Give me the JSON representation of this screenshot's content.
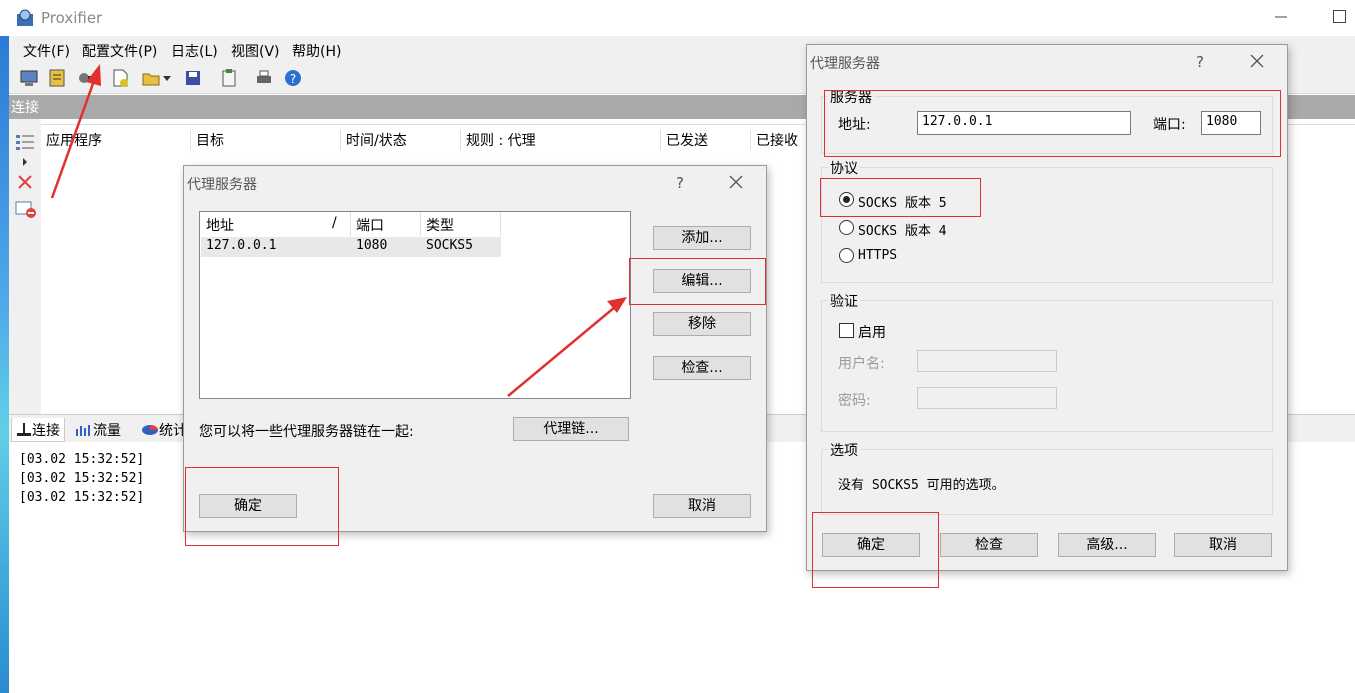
{
  "app": {
    "title": "Proxifier"
  },
  "menu": [
    "文件(F)",
    "配置文件(P)",
    "日志(L)",
    "视图(V)",
    "帮助(H)"
  ],
  "connections": {
    "title": "连接",
    "columns": [
      "应用程序",
      "目标",
      "时间/状态",
      "规则 : 代理",
      "已发送",
      "已接收"
    ]
  },
  "bottom_tabs": [
    "连接",
    "流量",
    "统计"
  ],
  "log_lines": [
    "[03.02 15:32:52]",
    "[03.02 15:32:52]",
    "[03.02 15:32:52]"
  ],
  "proxy_list_dialog": {
    "title": "代理服务器",
    "help": "?",
    "headers": {
      "address": "地址",
      "sort": "/",
      "port": "端口",
      "type": "类型"
    },
    "rows": [
      {
        "address": "127.0.0.1",
        "port": "1080",
        "type": "SOCKS5"
      }
    ],
    "buttons": {
      "add": "添加...",
      "edit": "编辑...",
      "remove": "移除",
      "check": "检查..."
    },
    "chain_text": "您可以将一些代理服务器链在一起:",
    "chain_button": "代理链...",
    "ok": "确定",
    "cancel": "取消"
  },
  "proxy_edit_dialog": {
    "title": "代理服务器",
    "help": "?",
    "server": {
      "group": "服务器",
      "address_label": "地址:",
      "address": "127.0.0.1",
      "port_label": "端口:",
      "port": "1080"
    },
    "protocol": {
      "group": "协议",
      "options": [
        "SOCKS 版本 5",
        "SOCKS 版本 4",
        "HTTPS"
      ],
      "selected": "SOCKS 版本 5"
    },
    "auth": {
      "group": "验证",
      "enable": "启用",
      "username_label": "用户名:",
      "password_label": "密码:"
    },
    "options": {
      "group": "选项",
      "text": "没有 SOCKS5 可用的选项。"
    },
    "buttons": {
      "ok": "确定",
      "check": "检查",
      "advanced": "高级...",
      "cancel": "取消"
    }
  },
  "colors": {
    "annotation": "#e03030",
    "selection": "#e8e8e8"
  }
}
